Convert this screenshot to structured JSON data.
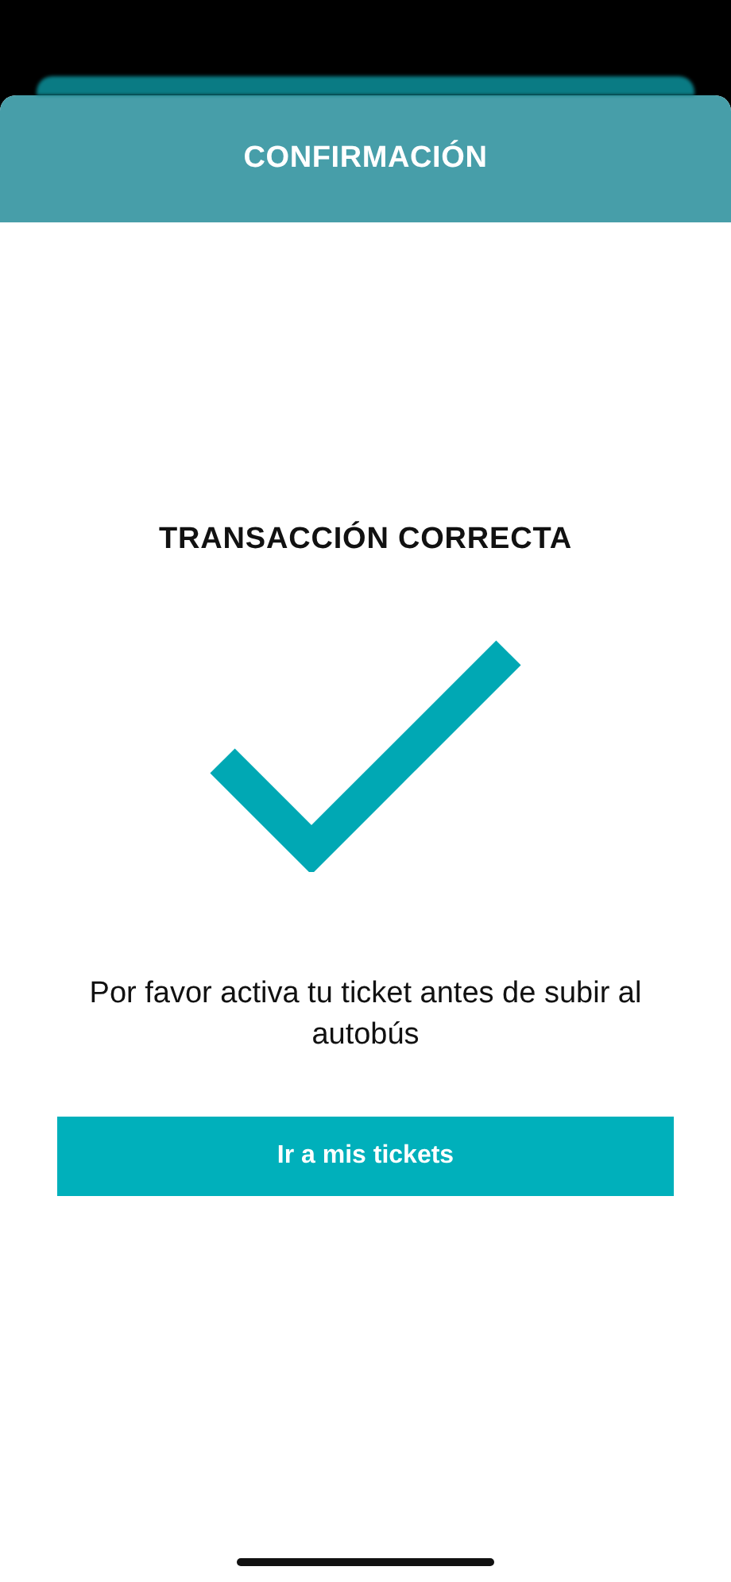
{
  "header": {
    "title": "CONFIRMACIÓN"
  },
  "status": {
    "title": "TRANSACCIÓN CORRECTA",
    "message": "Por favor activa tu ticket antes de subir al autobús"
  },
  "button": {
    "label": "Ir a mis tickets"
  }
}
